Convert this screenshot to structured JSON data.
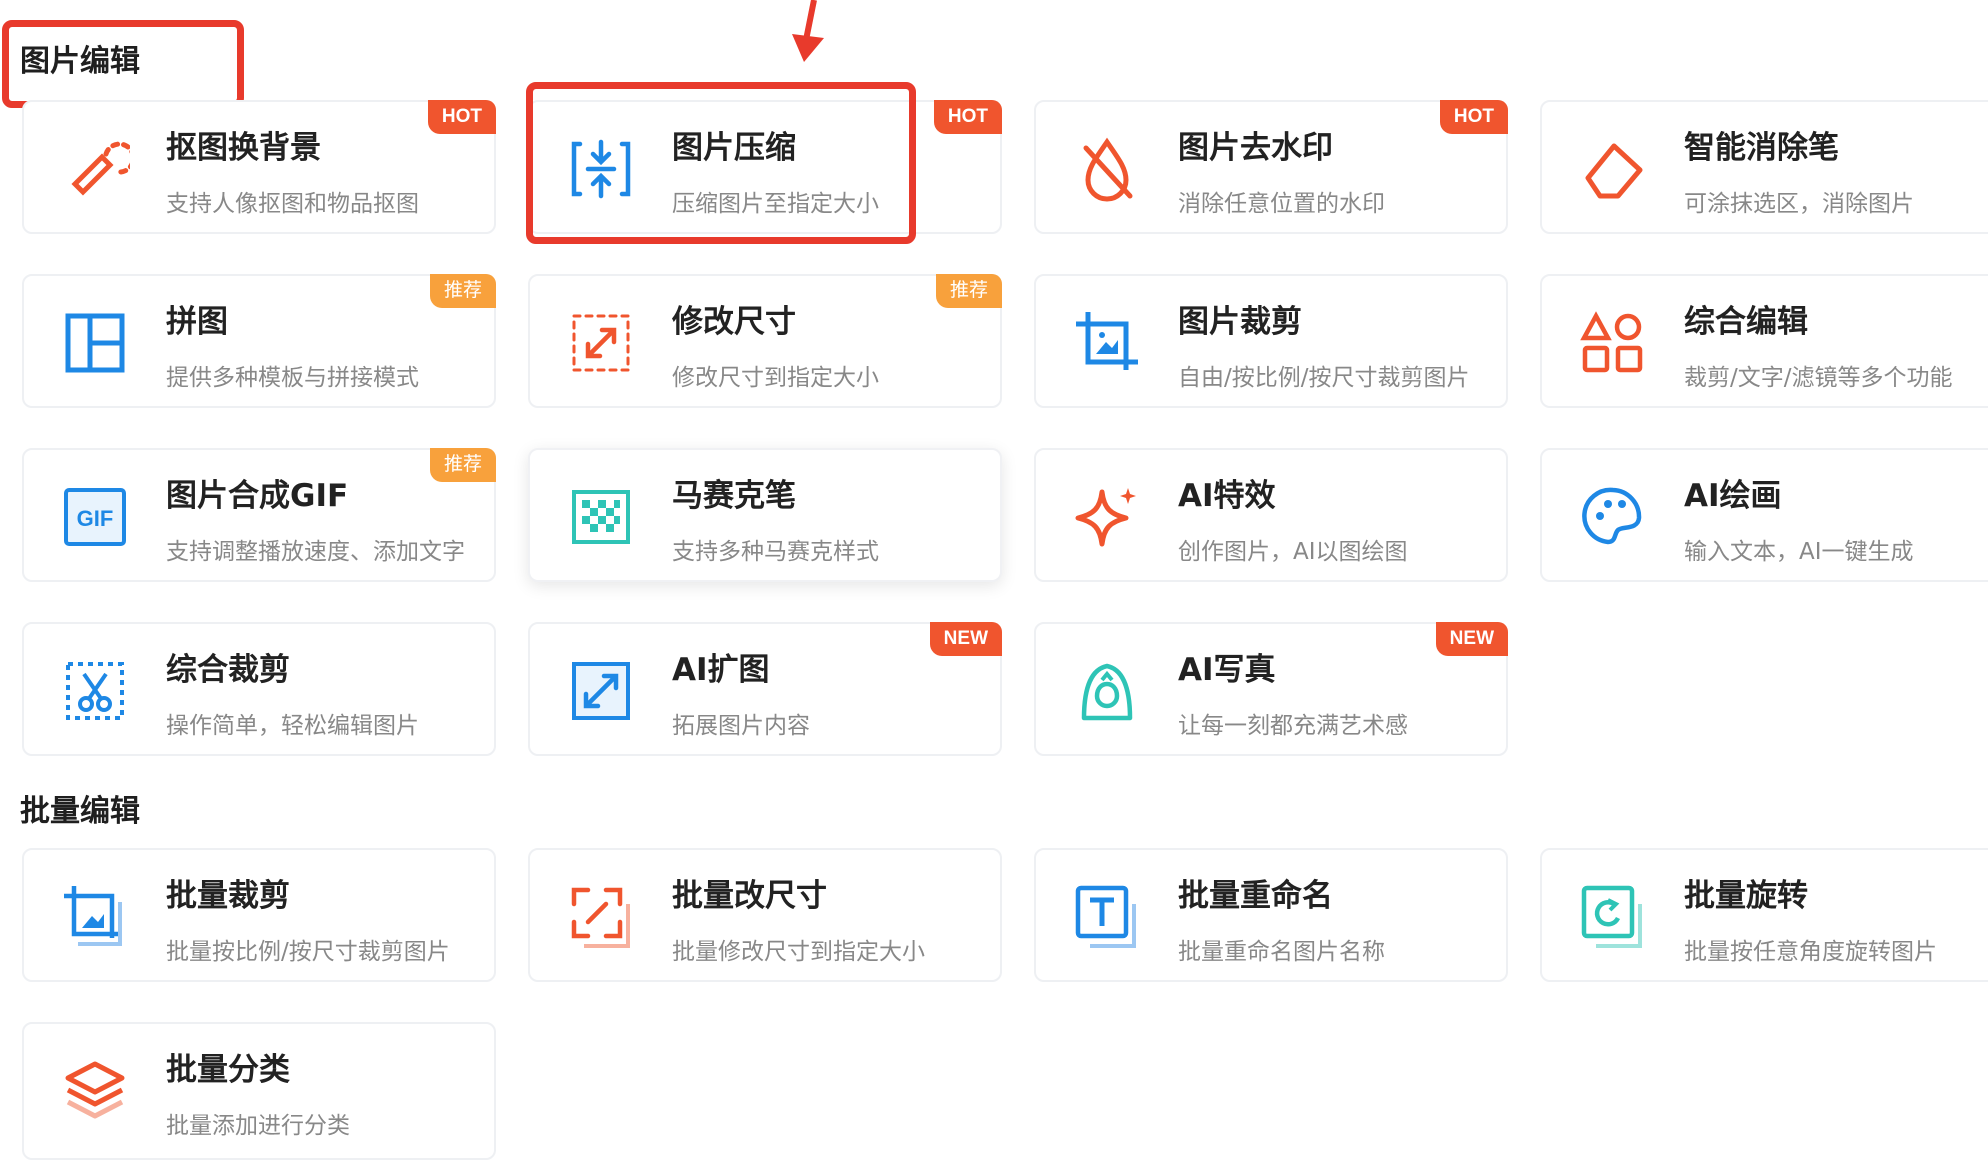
{
  "sections": {
    "image_edit": "图片编辑",
    "batch_edit": "批量编辑"
  },
  "tools": [
    {
      "title": "抠图换背景",
      "desc": "支持人像抠图和物品抠图",
      "badge": "HOT",
      "icon": "eyedropper-icon"
    },
    {
      "title": "图片压缩",
      "desc": "压缩图片至指定大小",
      "badge": "HOT",
      "icon": "compress-icon"
    },
    {
      "title": "图片去水印",
      "desc": "消除任意位置的水印",
      "badge": "HOT",
      "icon": "watermark-remove-icon"
    },
    {
      "title": "智能消除笔",
      "desc": "可涂抹选区，消除图片",
      "badge": "",
      "icon": "eraser-icon"
    },
    {
      "title": "拼图",
      "desc": "提供多种模板与拼接模式",
      "badge": "推荐",
      "icon": "collage-icon"
    },
    {
      "title": "修改尺寸",
      "desc": "修改尺寸到指定大小",
      "badge": "推荐",
      "icon": "resize-icon"
    },
    {
      "title": "图片裁剪",
      "desc": "自由/按比例/按尺寸裁剪图片",
      "badge": "",
      "icon": "crop-icon"
    },
    {
      "title": "综合编辑",
      "desc": "裁剪/文字/滤镜等多个功能",
      "badge": "",
      "icon": "shapes-icon"
    },
    {
      "title": "图片合成GIF",
      "desc": "支持调整播放速度、添加文字",
      "badge": "推荐",
      "icon": "gif-icon"
    },
    {
      "title": "马赛克笔",
      "desc": "支持多种马赛克样式",
      "badge": "",
      "icon": "mosaic-icon"
    },
    {
      "title": "AI特效",
      "desc": "创作图片，AI以图绘图",
      "badge": "",
      "icon": "sparkle-icon"
    },
    {
      "title": "AI绘画",
      "desc": "输入文本，AI一键生成",
      "badge": "",
      "icon": "palette-icon"
    },
    {
      "title": "综合裁剪",
      "desc": "操作简单，轻松编辑图片",
      "badge": "",
      "icon": "scissors-icon"
    },
    {
      "title": "AI扩图",
      "desc": "拓展图片内容",
      "badge": "NEW",
      "icon": "expand-icon"
    },
    {
      "title": "AI写真",
      "desc": "让每一刻都充满艺术感",
      "badge": "NEW",
      "icon": "portrait-icon"
    }
  ],
  "batch_tools": [
    {
      "title": "批量裁剪",
      "desc": "批量按比例/按尺寸裁剪图片",
      "icon": "batch-crop-icon"
    },
    {
      "title": "批量改尺寸",
      "desc": "批量修改尺寸到指定大小",
      "icon": "batch-resize-icon"
    },
    {
      "title": "批量重命名",
      "desc": "批量重命名图片名称",
      "icon": "batch-rename-icon"
    },
    {
      "title": "批量旋转",
      "desc": "批量按任意角度旋转图片",
      "icon": "batch-rotate-icon"
    },
    {
      "title": "批量分类",
      "desc": "批量添加进行分类",
      "icon": "layers-icon"
    }
  ],
  "colors": {
    "accent_orange": "#f0552e",
    "accent_blue": "#1e88e5",
    "accent_teal": "#2ec4b6",
    "annotation_red": "#e83a2c"
  }
}
